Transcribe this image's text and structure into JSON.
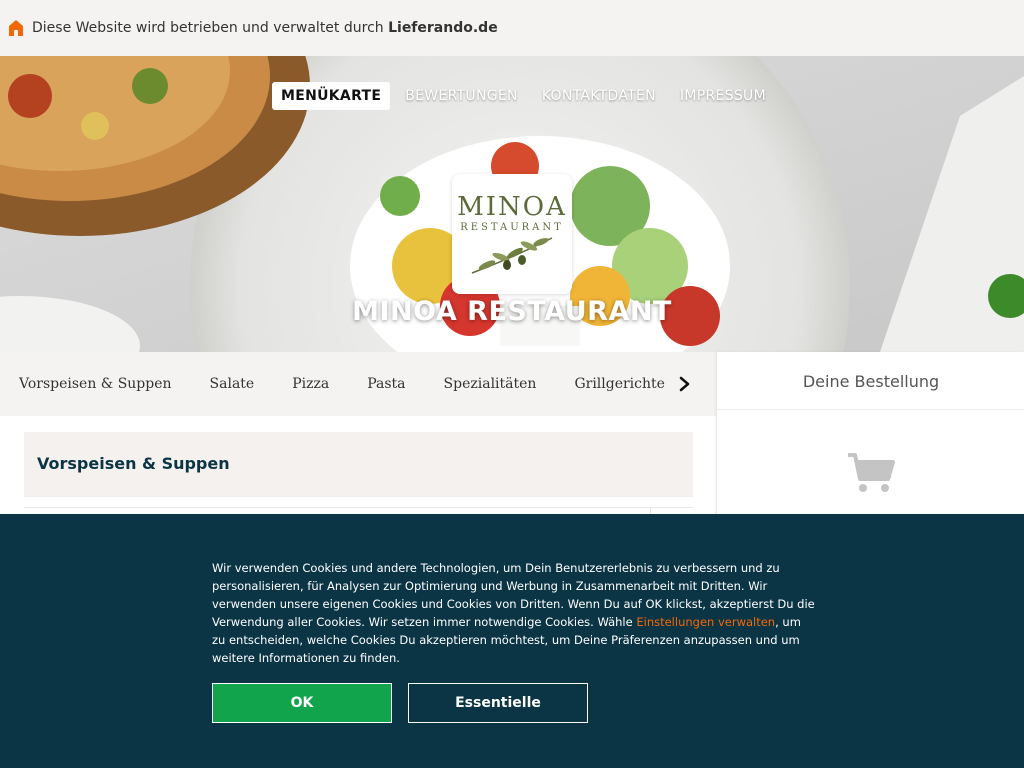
{
  "topbar": {
    "icon": "house-icon",
    "text_prefix": "Diese Website wird betrieben und verwaltet durch ",
    "text_brand": "Lieferando.de",
    "brand_color": "#f36805"
  },
  "nav": {
    "items": [
      {
        "label": "MENÜKARTE",
        "active": true
      },
      {
        "label": "BEWERTUNGEN",
        "active": false
      },
      {
        "label": "KONTAKTDATEN",
        "active": false
      },
      {
        "label": "IMPRESSUM",
        "active": false
      }
    ]
  },
  "hero": {
    "logo_text": "MINOA",
    "logo_subtext": "RESTAURANT",
    "restaurant_name": "MINOA RESTAURANT"
  },
  "categories": {
    "items": [
      "Vorspeisen & Suppen",
      "Salate",
      "Pizza",
      "Pasta",
      "Spezialitäten",
      "Grillgerichte"
    ],
    "next_icon": "chevron-right-icon"
  },
  "menu": {
    "section_title": "Vorspeisen & Suppen"
  },
  "order": {
    "title": "Deine Bestellung",
    "icon": "cart-icon"
  },
  "cookie": {
    "text_before_link": "Wir verwenden Cookies und andere Technologien, um Dein Benutzererlebnis zu verbessern und zu personalisieren, für Analysen zur Optimierung und Werbung in Zusammenarbeit mit Dritten. Wir verwenden unsere eigenen Cookies und Cookies von Dritten. Wenn Du auf OK klickst, akzeptierst Du die Verwendung aller Cookies. Wir setzen immer notwendige Cookies. Wähle ",
    "link_text": "Einstellungen verwalten",
    "text_after_link": ", um zu entscheiden, welche Cookies Du akzeptieren möchtest, um Deine Präferenzen anzupassen und um weitere Informationen zu finden.",
    "ok_label": "OK",
    "essential_label": "Essentielle",
    "background_color": "#0b3545",
    "ok_color": "#11a44d",
    "link_color": "#f36805"
  }
}
